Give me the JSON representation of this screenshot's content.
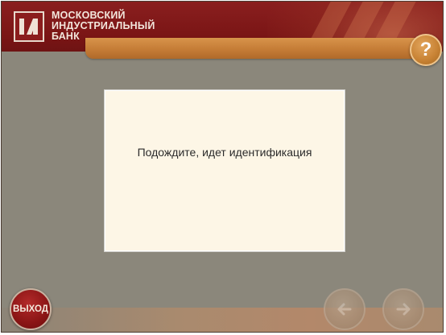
{
  "header": {
    "bank_name_lines": [
      "МОСКОВСКИЙ",
      "ИНДУСТРИАЛЬНЫЙ",
      "БАНК"
    ],
    "logo_icon": "bank-logo-icon",
    "help_label": "?"
  },
  "dialog": {
    "message": "Подождите, идет идентификация"
  },
  "footer": {
    "exit_label": "ВЫХОД",
    "back_icon": "arrow-left-icon",
    "forward_icon": "arrow-right-icon"
  },
  "colors": {
    "brand_red": "#8a1f1f",
    "accent_orange": "#c57c36",
    "background": "#8b877b",
    "dialog_bg": "#fdf6e6"
  }
}
